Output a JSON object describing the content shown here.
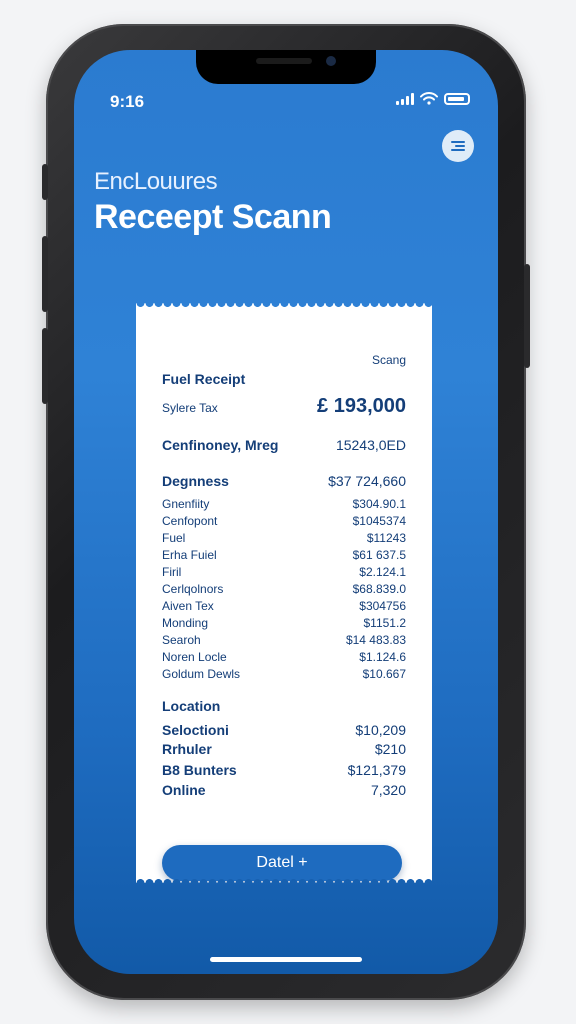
{
  "status": {
    "time": "9:16"
  },
  "header": {
    "brand": "EncLouures",
    "title": "Receept Scann"
  },
  "receipt": {
    "corner_label": "Scang",
    "heading": "Fuel Receipt",
    "total_label": "Sylere Tax",
    "total_value": "£ 193,000",
    "summary_label": "Cenfinoney, Mreg",
    "summary_value": "15243,0ED",
    "section1": {
      "label": "Degnness",
      "value": "$37 724,660",
      "rows": [
        {
          "label": "Gnenfiity",
          "value": "$304.90.1"
        },
        {
          "label": "Cenfopont",
          "value": "$1045374"
        },
        {
          "label": "Fuel",
          "value": "$11243"
        },
        {
          "label": "Erha Fuiel",
          "value": "$61 637.5"
        },
        {
          "label": "Firil",
          "value": "$2.124.1"
        },
        {
          "label": "Cerlqolnors",
          "value": "$68.839.0"
        },
        {
          "label": "Aiven Tex",
          "value": "$304756"
        },
        {
          "label": "Monding",
          "value": "$1151.2"
        },
        {
          "label": "Searoh",
          "value": "$14 483.83"
        },
        {
          "label": "Noren Locle",
          "value": "$1.124.6"
        },
        {
          "label": "Goldum Dewls",
          "value": "$10.667"
        }
      ]
    },
    "section2": {
      "label": "Location",
      "rows": [
        {
          "label": "Seloctioni",
          "value": "$10,209"
        },
        {
          "label": "Rrhuler",
          "value": "$210"
        },
        {
          "label": "B8 Bunters",
          "value": "$121,379"
        },
        {
          "label": "Online",
          "value": "7,320"
        }
      ]
    },
    "button_label": "Datel +"
  }
}
